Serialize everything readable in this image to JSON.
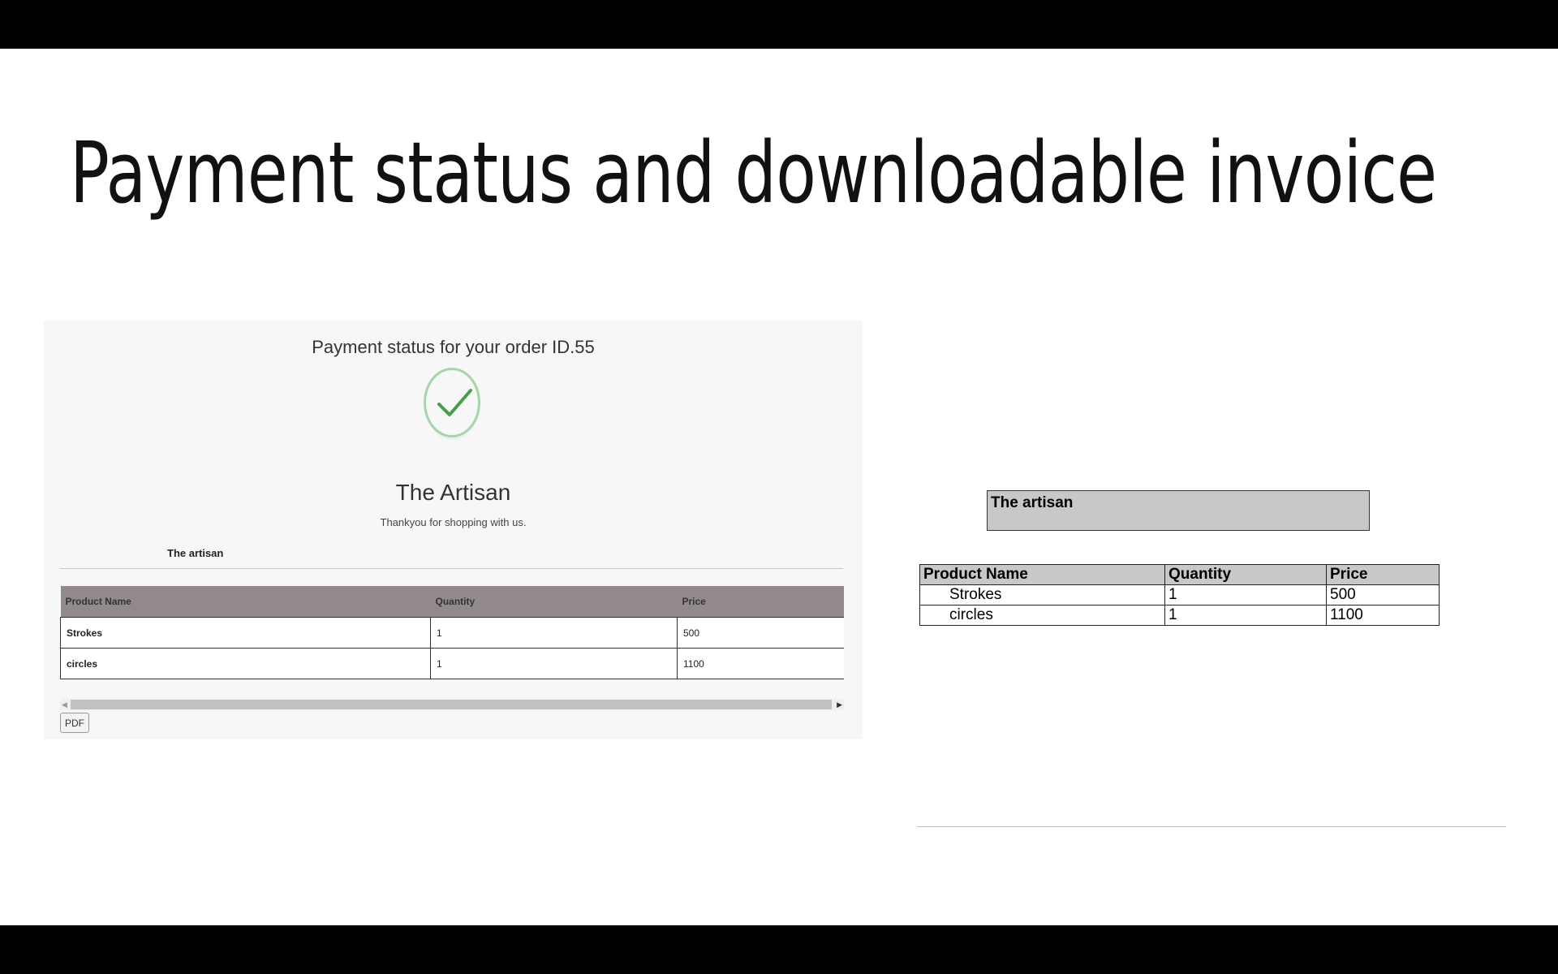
{
  "slide": {
    "title": "Payment status and downloadable invoice"
  },
  "web_view": {
    "status_title": "Payment status for your order ID.55",
    "status_icon": "check-circle-icon",
    "shop_name": "The Artisan",
    "thanks_text": "Thankyou for shopping with us.",
    "artisan_label": "The artisan",
    "table": {
      "headers": [
        "Product Name",
        "Quantity",
        "Price"
      ],
      "rows": [
        [
          "Strokes",
          "1",
          "500"
        ],
        [
          "circles",
          "1",
          "1100"
        ]
      ]
    },
    "pdf_button": "PDF"
  },
  "pdf_preview": {
    "header": "The artisan",
    "table": {
      "headers": [
        "Product Name",
        "Quantity",
        "Price"
      ],
      "rows": [
        [
          "Strokes",
          "1",
          "500"
        ],
        [
          "circles",
          "1",
          "1100"
        ]
      ]
    }
  },
  "colors": {
    "header_bar": "#000000",
    "table_header_bg": "#928a8a",
    "check_green": "#43a047",
    "check_ring": "#a5d6a7",
    "pdf_header_bg": "#c8c8c8"
  }
}
